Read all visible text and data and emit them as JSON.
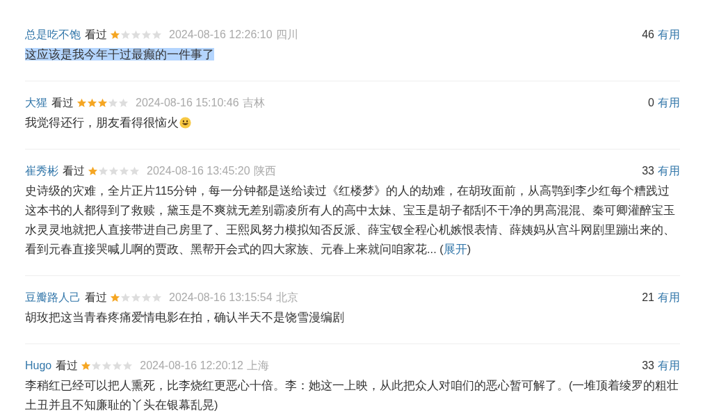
{
  "comments": [
    {
      "user": "总是吃不饱",
      "status": "看过",
      "stars": 1,
      "time": "2024-08-16 12:26:10",
      "region": "四川",
      "votes": "46",
      "vote_label": "有用",
      "text": "这应该是我今年干过最癫的一件事了",
      "highlighted": true,
      "emoji": false
    },
    {
      "user": "大猩",
      "status": "看过",
      "stars": 3,
      "time": "2024-08-16 15:10:46",
      "region": "吉林",
      "votes": "0",
      "vote_label": "有用",
      "text": "我觉得还行，朋友看得很恼火",
      "highlighted": false,
      "emoji": true
    },
    {
      "user": "崔秀彬",
      "status": "看过",
      "stars": 1,
      "time": "2024-08-16 13:45:20",
      "region": "陕西",
      "votes": "33",
      "vote_label": "有用",
      "text": "史诗级的灾难，全片正片115分钟，每一分钟都是送给读过《红楼梦》的人的劫难，在胡玫面前，从高鹗到李少红每个糟践过这本书的人都得到了救赎，黛玉是不爽就无差别霸凌所有人的高中太妹、宝玉是胡子都刮不干净的男高混混、秦可卿灌醉宝玉水灵灵地就把人直接带进自己房里了、王熙凤努力模拟知否反派、薛宝钗全程心机嫉恨表情、薛姨妈从宫斗网剧里蹦出来的、看到元春直接哭喊儿啊的贾政、黑帮开会式的四大家族、元春上来就问咱家花...",
      "highlighted": false,
      "emoji": false,
      "expand": {
        "before": " (",
        "label": "展开",
        "after": ")"
      }
    },
    {
      "user": "豆瓣路人己",
      "status": "看过",
      "stars": 1,
      "time": "2024-08-16 13:15:54",
      "region": "北京",
      "votes": "21",
      "vote_label": "有用",
      "text": "胡玫把这当青春疼痛爱情电影在拍，确认半天不是饶雪漫编剧",
      "highlighted": false,
      "emoji": false
    },
    {
      "user": "Hugo",
      "status": "看过",
      "stars": 1,
      "time": "2024-08-16 12:20:12",
      "region": "上海",
      "votes": "33",
      "vote_label": "有用",
      "text": "李稍红已经可以把人熏死，比李烧红更恶心十倍。李：她这一上映，从此把众人对咱们的恶心暂可解了。(一堆顶着绫罗的粗壮土丑并且不知廉耻的丫头在银幕乱晃)",
      "highlighted": false,
      "emoji": false
    }
  ]
}
